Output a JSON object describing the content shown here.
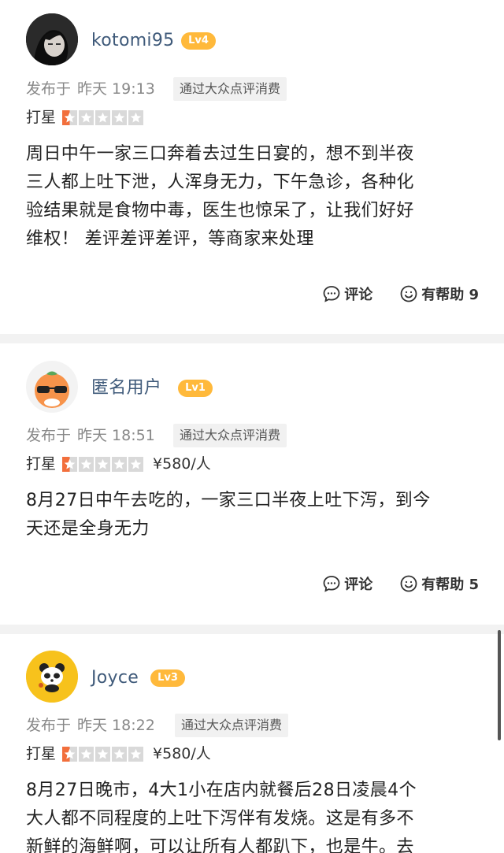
{
  "rating_label": "打星",
  "reviews": [
    {
      "username": "kotomi95",
      "level": "Lv4",
      "published_prefix": "发布于",
      "published_time": "昨天 19:13",
      "tag": "通过大众点评消费",
      "stars": 0.5,
      "price": "",
      "content_lines": [
        "周日中午一家三口奔着去过生日宴的，想不到半夜",
        "三人都上吐下泄，人浑身无力，下午急诊，各种化",
        "验结果就是食物中毒，医生也惊呆了，让我们好好",
        "维权！ 差评差评差评，等商家来处理"
      ],
      "comment_label": "评论",
      "helpful_label": "有帮助 9"
    },
    {
      "username": "匿名用户",
      "level": "Lv1",
      "published_prefix": "发布于",
      "published_time": "昨天 18:51",
      "tag": "通过大众点评消费",
      "stars": 0.5,
      "price": "¥580/人",
      "content_lines": [
        "8月27日中午去吃的，一家三口半夜上吐下泻，到今",
        "天还是全身无力"
      ],
      "comment_label": "评论",
      "helpful_label": "有帮助 5"
    },
    {
      "username": "Joyce",
      "level": "Lv3",
      "published_prefix": "发布于",
      "published_time": "昨天 18:22",
      "tag": "通过大众点评消费",
      "stars": 0.5,
      "price": "¥580/人",
      "content_lines": [
        "8月27日晚市，4大1小在店内就餐后28日凌晨4个",
        "大人都不同程度的上吐下泻伴有发烧。这是有多不",
        "新鲜的海鲜啊，可以让所有人都趴下，也是牛。去"
      ]
    }
  ],
  "colors": {
    "star_active": "#f26f3c",
    "star_inactive": "#d9d9d9",
    "level_badge": "#ffb93b",
    "username": "#3f5a7a"
  }
}
